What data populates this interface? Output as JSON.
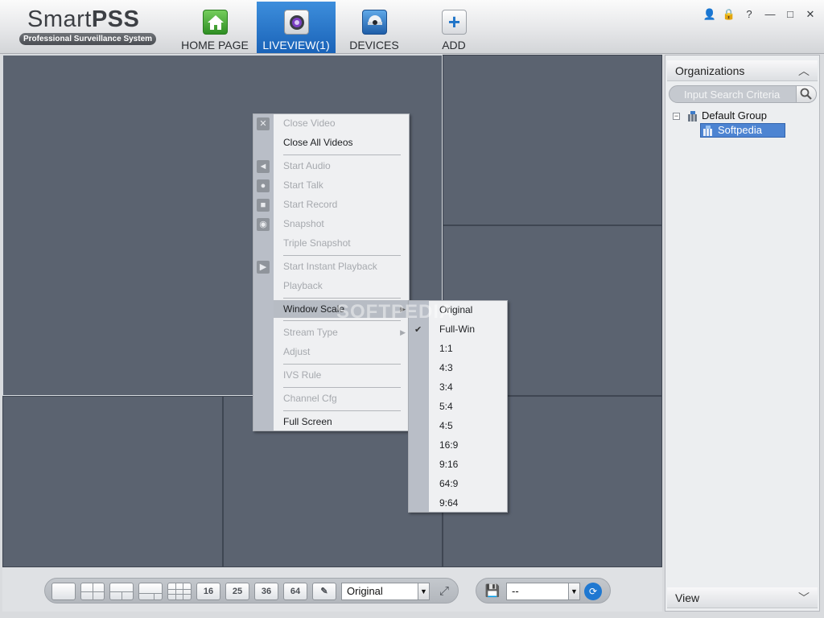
{
  "app": {
    "name_plain": "Smart",
    "name_bold": "PSS",
    "subtitle": "Professional Surveillance System"
  },
  "nav": {
    "tabs": [
      {
        "label": "HOME PAGE",
        "icon": "home-icon"
      },
      {
        "label": "LIVEVIEW(1)",
        "icon": "camera-icon",
        "active": true
      },
      {
        "label": "DEVICES",
        "icon": "dome-camera-icon"
      },
      {
        "label": "ADD",
        "icon": "plus-icon"
      }
    ]
  },
  "window_controls": {
    "user": "👤",
    "lock": "🔒",
    "help": "?",
    "minimize": "—",
    "maximize": "□",
    "close": "✕"
  },
  "context_menu": {
    "items": [
      {
        "label": "Close Video",
        "enabled": false,
        "icon": "close-icon"
      },
      {
        "label": "Close All Videos",
        "enabled": true
      },
      {
        "label": "Start Audio",
        "enabled": false,
        "icon": "audio-icon"
      },
      {
        "label": "Start Talk",
        "enabled": false,
        "icon": "microphone-icon"
      },
      {
        "label": "Start Record",
        "enabled": false,
        "icon": "record-icon"
      },
      {
        "label": "Snapshot",
        "enabled": false,
        "icon": "snapshot-icon"
      },
      {
        "label": "Triple Snapshot",
        "enabled": false
      },
      {
        "label": "Start Instant Playback",
        "enabled": false,
        "icon": "playback-icon"
      },
      {
        "label": "Playback",
        "enabled": false
      },
      {
        "label": "Window Scale",
        "enabled": true,
        "submenu": true,
        "highlighted": true
      },
      {
        "label": "Stream Type",
        "enabled": false,
        "submenu": true
      },
      {
        "label": "Adjust",
        "enabled": false
      },
      {
        "label": "IVS Rule",
        "enabled": false
      },
      {
        "label": "Channel Cfg",
        "enabled": false
      },
      {
        "label": "Full Screen",
        "enabled": true
      }
    ]
  },
  "window_scale_menu": {
    "items": [
      "Original",
      "Full-Win",
      "1:1",
      "4:3",
      "3:4",
      "5:4",
      "4:5",
      "16:9",
      "9:16",
      "64:9",
      "9:64"
    ],
    "checked": "Full-Win"
  },
  "watermark": "SOFTPEDIA",
  "organizations": {
    "title": "Organizations",
    "search_placeholder": "Input Search Criteria",
    "tree": [
      {
        "label": "Default Group",
        "expanded": true,
        "children": [
          {
            "label": "Softpedia",
            "selected": true
          }
        ]
      }
    ]
  },
  "view_panel": {
    "title": "View"
  },
  "toolbar": {
    "layout_buttons": [
      "1",
      "4",
      "6",
      "8",
      "9",
      "16",
      "25",
      "36",
      "64"
    ],
    "scale_select": "Original",
    "view_select": "--"
  },
  "colors": {
    "accent": "#1a63b8",
    "video_bg": "#5b6370",
    "menu_bg": "#eff0f2",
    "selection": "#4d84d2"
  }
}
